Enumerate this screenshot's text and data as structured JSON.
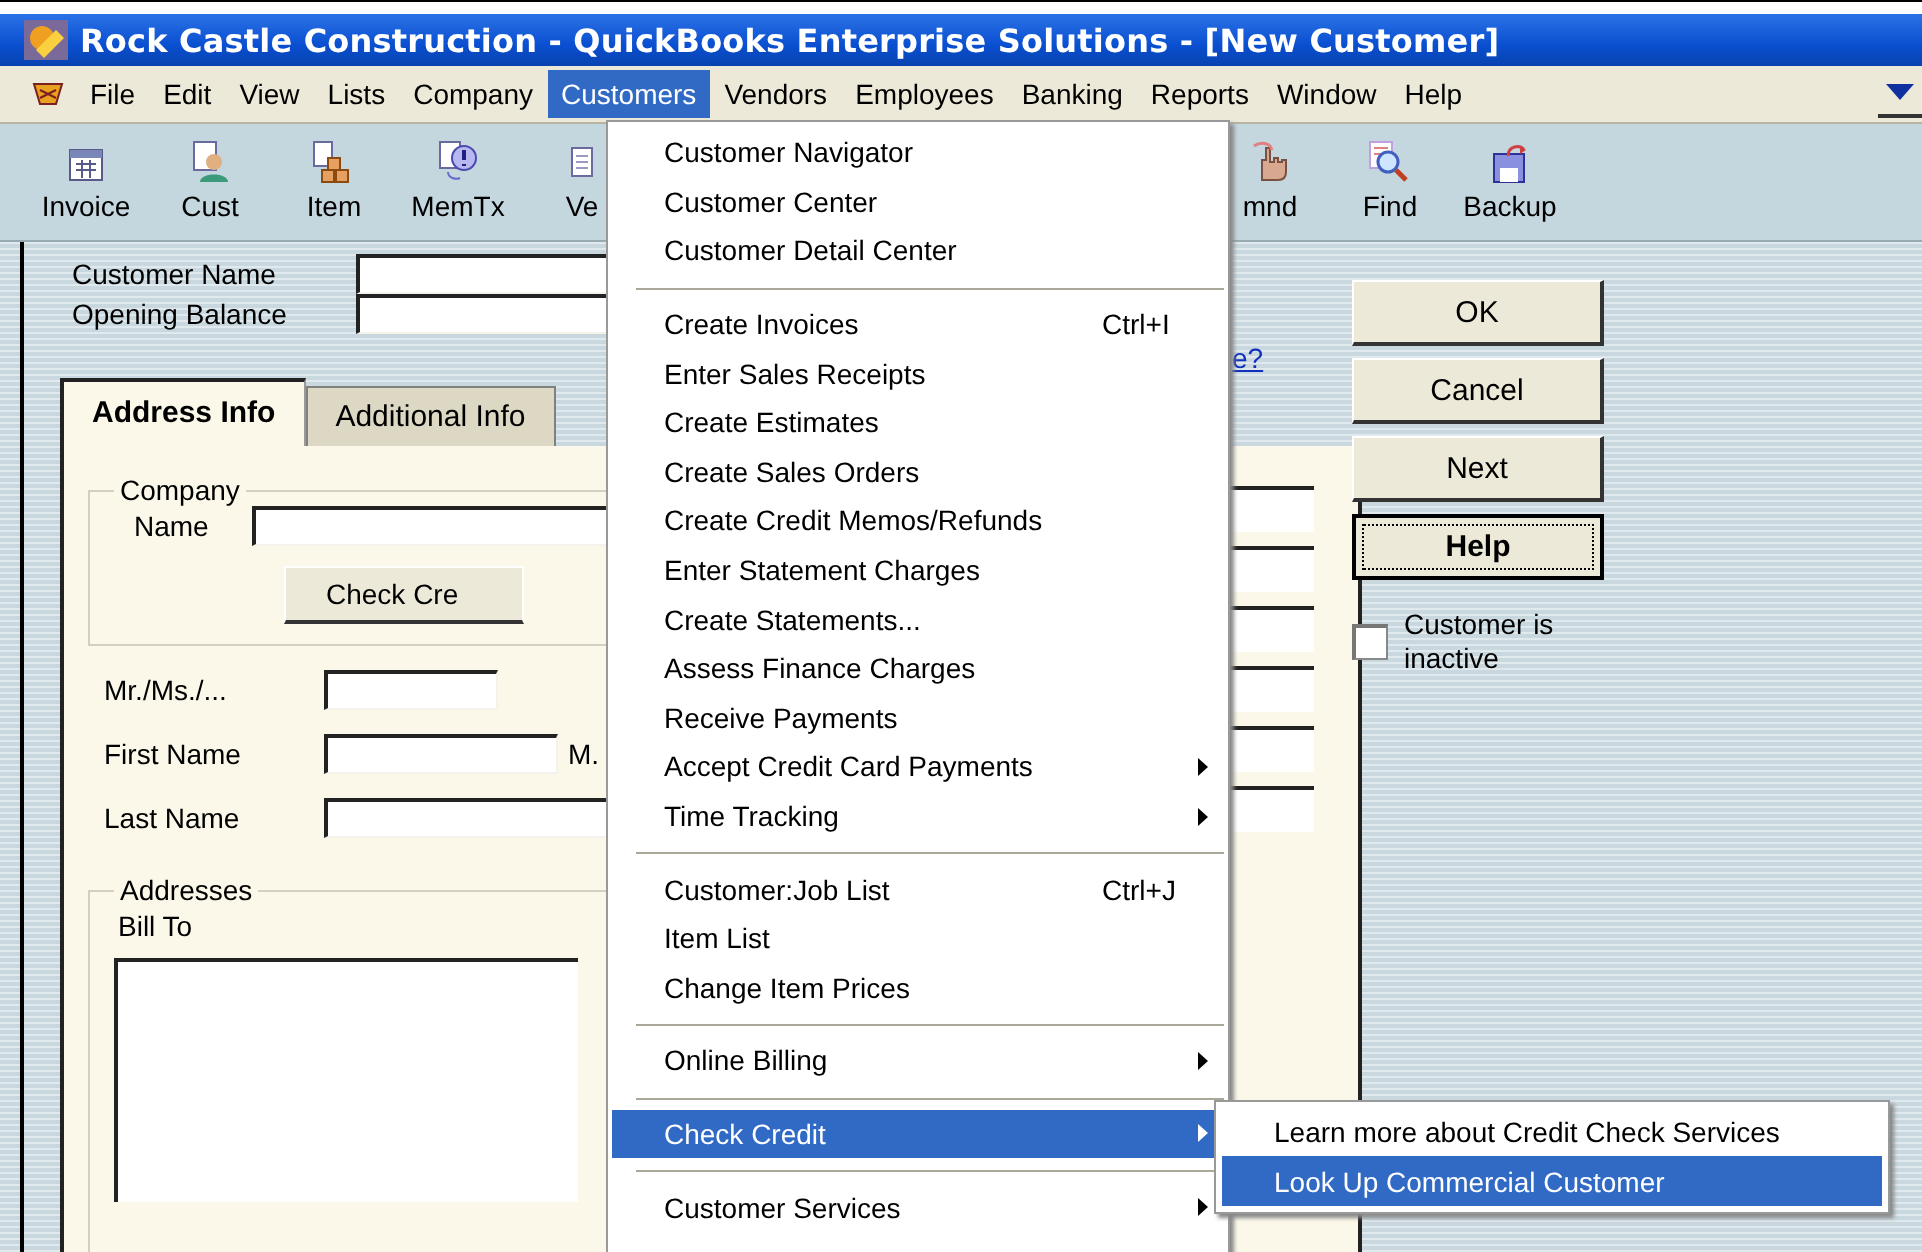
{
  "window": {
    "title": "Rock Castle Construction - QuickBooks Enterprise Solutions - [New Customer]"
  },
  "menu_bar": [
    {
      "label": "File",
      "selected": false
    },
    {
      "label": "Edit",
      "selected": false
    },
    {
      "label": "View",
      "selected": false
    },
    {
      "label": "Lists",
      "selected": false
    },
    {
      "label": "Company",
      "selected": false
    },
    {
      "label": "Customers",
      "selected": true
    },
    {
      "label": "Vendors",
      "selected": false
    },
    {
      "label": "Employees",
      "selected": false
    },
    {
      "label": "Banking",
      "selected": false
    },
    {
      "label": "Reports",
      "selected": false
    },
    {
      "label": "Window",
      "selected": false
    },
    {
      "label": "Help",
      "selected": false
    }
  ],
  "toolbar": {
    "left": [
      {
        "label": "Invoice",
        "kind": "invoice"
      },
      {
        "label": "Cust",
        "kind": "cust"
      },
      {
        "label": "Item",
        "kind": "item"
      },
      {
        "label": "MemTx",
        "kind": "memtx"
      },
      {
        "label": "Ve",
        "kind": "doc"
      }
    ],
    "right": [
      {
        "label": "mnd",
        "kind": "hand"
      },
      {
        "label": "Find",
        "kind": "find"
      },
      {
        "label": "Backup",
        "kind": "backup"
      }
    ]
  },
  "form": {
    "fields": [
      {
        "label": "Customer Name"
      },
      {
        "label": "Opening Balance"
      }
    ],
    "link": "e?",
    "tabs": [
      {
        "label": "Address Info",
        "selected": true
      },
      {
        "label": "Additional Info",
        "selected": false
      }
    ],
    "company": {
      "title": "Company",
      "name_label": "Name",
      "button": "Check Cre"
    },
    "person": [
      {
        "label": "Mr./Ms./..."
      },
      {
        "label": "First Name",
        "extra_label": "M."
      },
      {
        "label": "Last Name"
      }
    ],
    "addresses": {
      "title": "Addresses",
      "bill_to": "Bill To"
    }
  },
  "buttons": [
    {
      "label": "OK",
      "default": false
    },
    {
      "label": "Cancel",
      "default": false
    },
    {
      "label": "Next",
      "default": false
    },
    {
      "label": "Help",
      "default": true
    }
  ],
  "inactive": {
    "label": "Customer is inactive",
    "checked": false
  },
  "menu": {
    "groups": [
      [
        {
          "label": "Customer Navigator",
          "submenu": false,
          "selected": false
        },
        {
          "label": "Customer Center",
          "submenu": false,
          "selected": false
        },
        {
          "label": "Customer Detail Center",
          "submenu": false,
          "selected": false
        }
      ],
      [
        {
          "label": "Create Invoices",
          "shortcut": "Ctrl+I",
          "submenu": false,
          "selected": false
        },
        {
          "label": "Enter Sales Receipts",
          "submenu": false,
          "selected": false
        },
        {
          "label": "Create Estimates",
          "submenu": false,
          "selected": false
        },
        {
          "label": "Create Sales Orders",
          "submenu": false,
          "selected": false
        },
        {
          "label": "Create Credit Memos/Refunds",
          "submenu": false,
          "selected": false
        },
        {
          "label": "Enter Statement Charges",
          "submenu": false,
          "selected": false
        },
        {
          "label": "Create Statements...",
          "submenu": false,
          "selected": false
        },
        {
          "label": "Assess Finance Charges",
          "submenu": false,
          "selected": false
        },
        {
          "label": "Receive Payments",
          "submenu": false,
          "selected": false
        },
        {
          "label": "Accept Credit Card Payments",
          "submenu": true,
          "selected": false
        },
        {
          "label": "Time Tracking",
          "submenu": true,
          "selected": false
        }
      ],
      [
        {
          "label": "Customer:Job List",
          "shortcut": "Ctrl+J",
          "submenu": false,
          "selected": false
        },
        {
          "label": "Item List",
          "submenu": false,
          "selected": false
        },
        {
          "label": "Change Item Prices",
          "submenu": false,
          "selected": false
        }
      ],
      [
        {
          "label": "Online Billing",
          "submenu": true,
          "selected": false
        }
      ],
      [
        {
          "label": "Check Credit",
          "submenu": true,
          "selected": true
        }
      ],
      [
        {
          "label": "Customer Services",
          "submenu": true,
          "selected": false
        }
      ]
    ]
  },
  "submenu": [
    {
      "label": "Learn more about Credit Check Services",
      "selected": false
    },
    {
      "label": "Look Up Commercial Customer",
      "selected": true
    }
  ]
}
